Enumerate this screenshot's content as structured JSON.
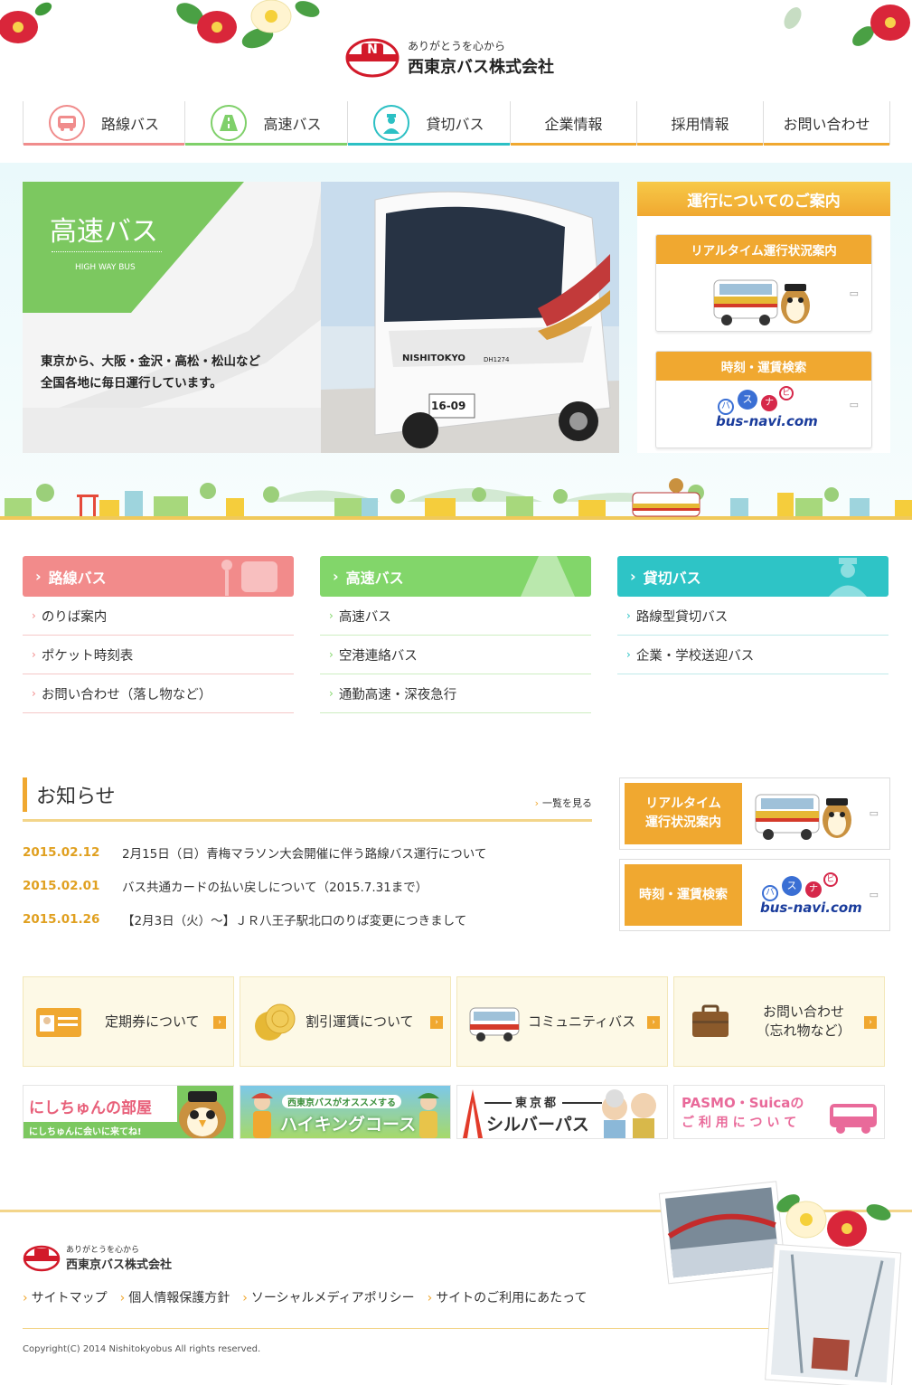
{
  "logo": {
    "tagline": "ありがとうを心から",
    "company": "西東京バス株式会社",
    "mark": "N"
  },
  "gnav": [
    {
      "label": "路線バス",
      "icon": "bus-icon",
      "color": "#f08c8c"
    },
    {
      "label": "高速バス",
      "icon": "highway-icon",
      "color": "#7fd06a"
    },
    {
      "label": "貸切バス",
      "icon": "driver-icon",
      "color": "#2cc0c4"
    },
    {
      "label": "企業情報"
    },
    {
      "label": "採用情報"
    },
    {
      "label": "お問い合わせ"
    }
  ],
  "hero": {
    "title": "高速バス",
    "subtitle": "HIGH WAY BUS",
    "text1": "東京から、大阪・金沢・高松・松山など",
    "text2": "全国各地に毎日運行しています。",
    "bus_plate": "16-09",
    "bus_brand": "NISHITOKYO",
    "bus_code": "DH1274"
  },
  "operation": {
    "title": "運行についてのご案内",
    "realtime": "リアルタイム運行状況案内",
    "search": "時刻・運賃検索",
    "busnavi_kana": [
      "バ",
      "ス",
      "ナ",
      "ビ"
    ],
    "busnavi": "bus-navi.com"
  },
  "columns": [
    {
      "title": "路線バス",
      "color": "#f28b8b",
      "line": "#f5c8c8",
      "items": [
        "のりば案内",
        "ポケット時刻表",
        "お問い合わせ（落し物など）"
      ]
    },
    {
      "title": "高速バス",
      "color": "#82d66a",
      "line": "#cdeec1",
      "items": [
        "高速バス",
        "空港連絡バス",
        "通勤高速・深夜急行"
      ]
    },
    {
      "title": "貸切バス",
      "color": "#2ec4c6",
      "line": "#bfeaea",
      "items": [
        "路線型貸切バス",
        "企業・学校送迎バス"
      ]
    }
  ],
  "news": {
    "title": "お知らせ",
    "more": "一覧を見る",
    "items": [
      {
        "date": "2015.02.12",
        "text": "2月15日（日）青梅マラソン大会開催に伴う路線バス運行について"
      },
      {
        "date": "2015.02.01",
        "text": "バス共通カードの払い戻しについて（2015.7.31まで）"
      },
      {
        "date": "2015.01.26",
        "text": "【2月3日（火）～】ＪＲ八王子駅北口のりば変更につきまして"
      }
    ]
  },
  "side": {
    "realtime": "リアルタイム運行状況案内",
    "search": "時刻・運賃検索"
  },
  "info": [
    {
      "label": "定期券について"
    },
    {
      "label": "割引運賃について"
    },
    {
      "label": "コミュニティバス"
    },
    {
      "label": "お問い合わせ（忘れ物など）"
    }
  ],
  "banners": {
    "b1a": "にしちゅんの部屋",
    "b1b": "にしちゅんに会いに来てね!",
    "b2a": "西東京バスがオススメする",
    "b2b": "ハイキングコース",
    "b3a": "東京都",
    "b3b": "シルバーパス",
    "b4a": "PASMO・Suicaの",
    "b4b": "ご 利 用 に つ い て"
  },
  "footer": {
    "tagline": "ありがとうを心から",
    "company": "西東京バス株式会社",
    "links": [
      "サイトマップ",
      "個人情報保護方針",
      "ソーシャルメディアポリシー",
      "サイトのご利用にあたって"
    ],
    "copyright": "Copyright(C) 2014 Nishitokyobus All rights reserved."
  }
}
